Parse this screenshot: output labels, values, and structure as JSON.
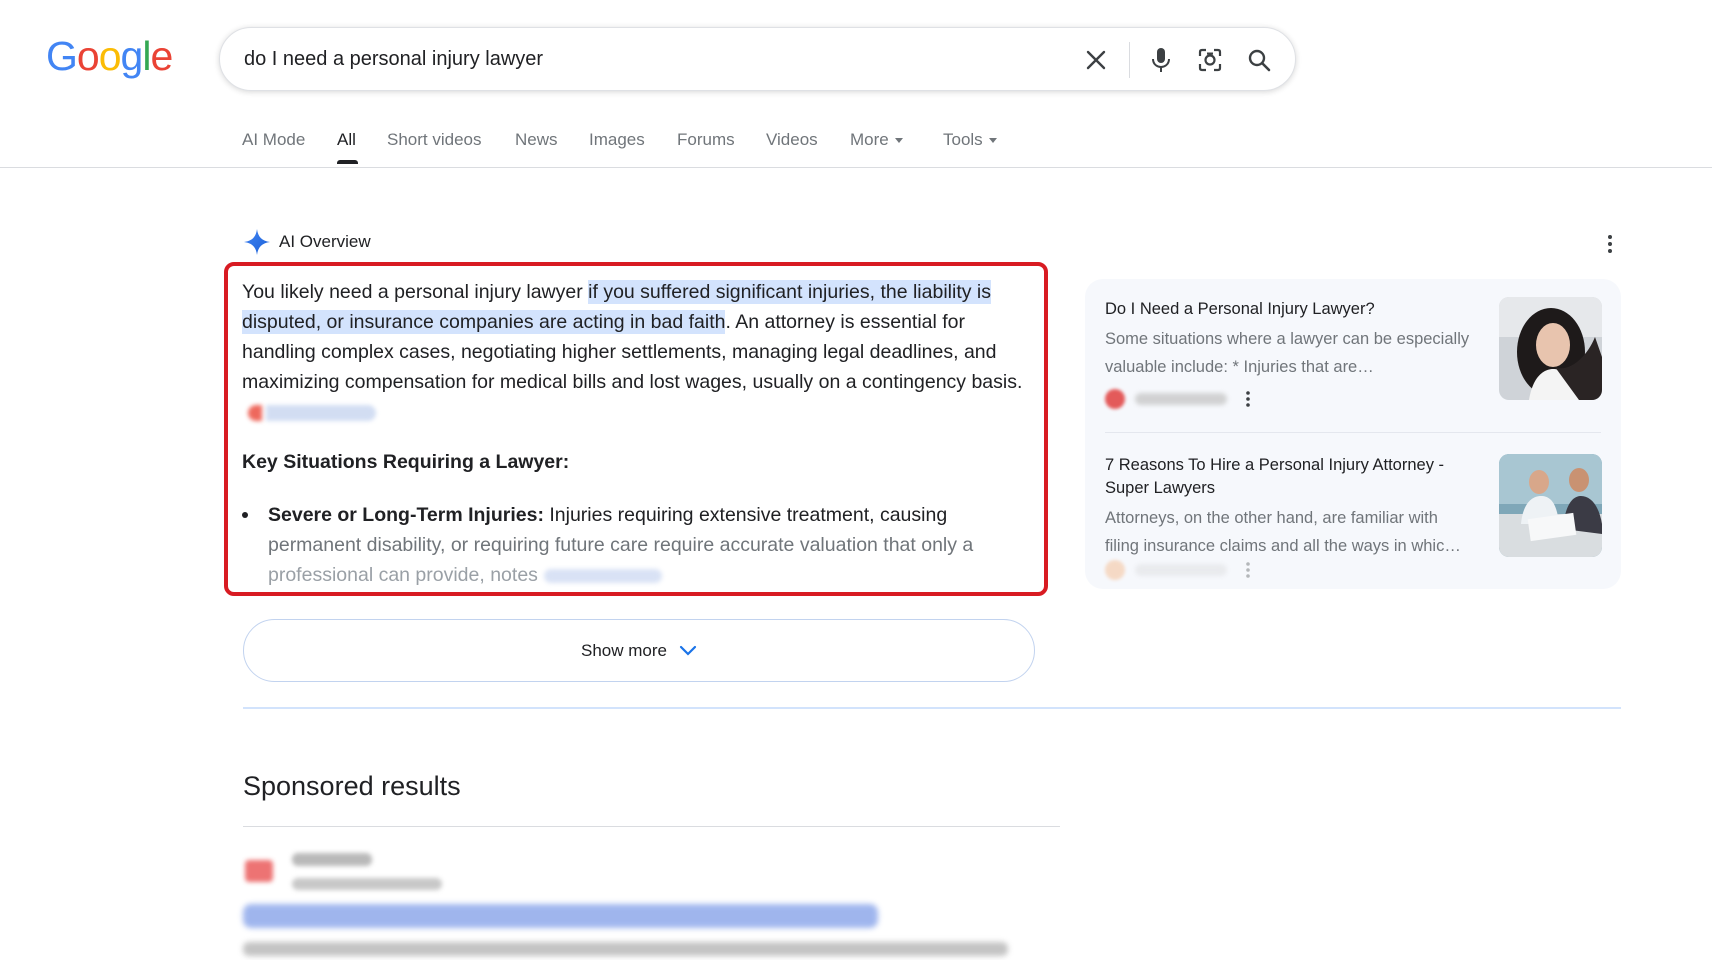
{
  "logo": {
    "letters": [
      "G",
      "o",
      "o",
      "g",
      "l",
      "e"
    ],
    "colors": [
      "#4285F4",
      "#EA4335",
      "#FBBC05",
      "#4285F4",
      "#34A853",
      "#EA4335"
    ]
  },
  "search": {
    "query": "do I need a personal injury lawyer"
  },
  "tabs": [
    {
      "label": "AI Mode"
    },
    {
      "label": "All",
      "active": true
    },
    {
      "label": "Short videos"
    },
    {
      "label": "News"
    },
    {
      "label": "Images"
    },
    {
      "label": "Forums"
    },
    {
      "label": "Videos"
    },
    {
      "label": "More"
    },
    {
      "label": "Tools"
    }
  ],
  "ai_overview": {
    "title": "AI Overview",
    "intro_before": "You likely need a personal injury lawyer",
    "intro_highlight_1": "if you suffered significant injuries, the liability is",
    "intro_highlight_2": "disputed, or insurance companies are acting in bad faith",
    "intro_after": ". An attorney is essential for handling complex cases, negotiating higher settlements, managing legal deadlines, and maximizing compensation for medical bills and lost wages, usually on a contingency basis.",
    "subheading": "Key Situations Requiring a Lawyer:",
    "bullet_bold": "Severe or Long-Term Injuries:",
    "bullet_text": " Injuries requiring extensive treatment, causing",
    "bullet_line2": "permanent disability, or requiring future care require accurate valuation that only a",
    "bullet_line3": "professional can provide, notes",
    "show_more": "Show more"
  },
  "sources": [
    {
      "title": "Do I Need a Personal Injury Lawyer?",
      "snippet": "Some situations where a lawyer can be especially valuable include: * Injuries that are…"
    },
    {
      "title": "7 Reasons To Hire a Personal Injury Attorney - Super Lawyers",
      "snippet": "Attorneys, on the other hand, are familiar with filing insurance claims and all the ways in whic…"
    }
  ],
  "sponsored": {
    "heading": "Sponsored results"
  }
}
